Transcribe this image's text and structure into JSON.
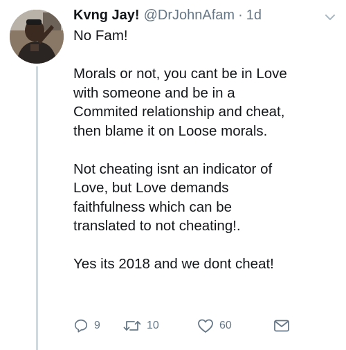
{
  "tweet": {
    "display_name": "Kvng Jay!",
    "handle": "@DrJohnAfam",
    "separator": "·",
    "timestamp": "1d",
    "paragraphs": [
      [
        "No Fam!"
      ],
      [
        "Morals or not, you cant be in Love",
        "with someone and be in a",
        "Commited relationship and cheat,",
        "then blame it on Loose morals."
      ],
      [
        "Not cheating isnt an indicator of",
        "Love, but Love demands",
        "faithfulness which can be",
        "translated to not cheating!."
      ],
      [
        "Yes its 2018 and we dont cheat!"
      ]
    ]
  },
  "actions": {
    "reply_count": "9",
    "retweet_count": "10",
    "like_count": "60"
  },
  "icons": {
    "reply": "reply-icon",
    "retweet": "retweet-icon",
    "like": "heart-icon",
    "message": "envelope-icon",
    "menu": "chevron-down-icon"
  },
  "colors": {
    "text": "#14171a",
    "secondary": "#657786",
    "thread_line": "#cfd9de"
  }
}
